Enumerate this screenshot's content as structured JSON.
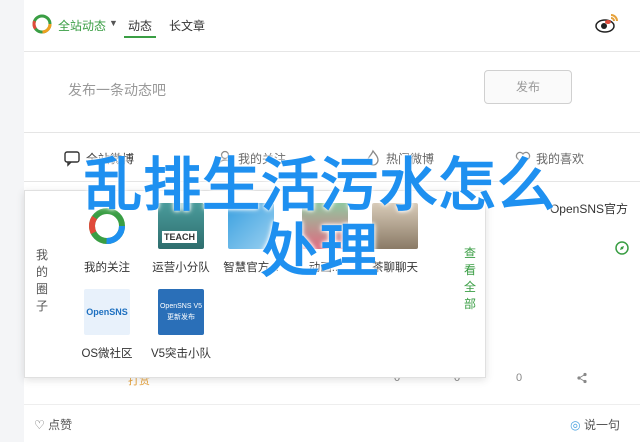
{
  "nav": {
    "site_label": "全站动态",
    "tabs": [
      "动态",
      "长文章"
    ]
  },
  "composer": {
    "placeholder": "发布一条动态吧",
    "publish_label": "发布"
  },
  "filters": [
    "全站微博",
    "我的关注",
    "热门微博",
    "我的喜欢"
  ],
  "feed": {
    "brand": "OpenSNS官方",
    "stats": [
      "打赏",
      "0",
      "0",
      "0"
    ]
  },
  "popup": {
    "my_circle": [
      "我",
      "的",
      "圈",
      "子"
    ],
    "view_all": [
      "查",
      "看",
      "全",
      "部"
    ],
    "items": [
      {
        "label": "我的关注"
      },
      {
        "label": "运营小分队"
      },
      {
        "label": "智慧官方..."
      },
      {
        "label": "动画..."
      },
      {
        "label": "茶聊聊天"
      },
      {
        "label": "OS微社区"
      },
      {
        "label": "V5突击小队"
      }
    ],
    "thumb_texts": {
      "teach": "TEACH",
      "opensns": "OpenSNS",
      "v5_title": "OpenSNS V5",
      "v5_sub": "更新发布"
    }
  },
  "bottom": {
    "like_label": "点赞",
    "say_label": "说一句"
  },
  "headline": {
    "line1": "乱排生活污水怎么",
    "line2": "处理"
  },
  "colors": {
    "accent_green": "#3a9e44",
    "headline_blue": "#1e90f0"
  }
}
